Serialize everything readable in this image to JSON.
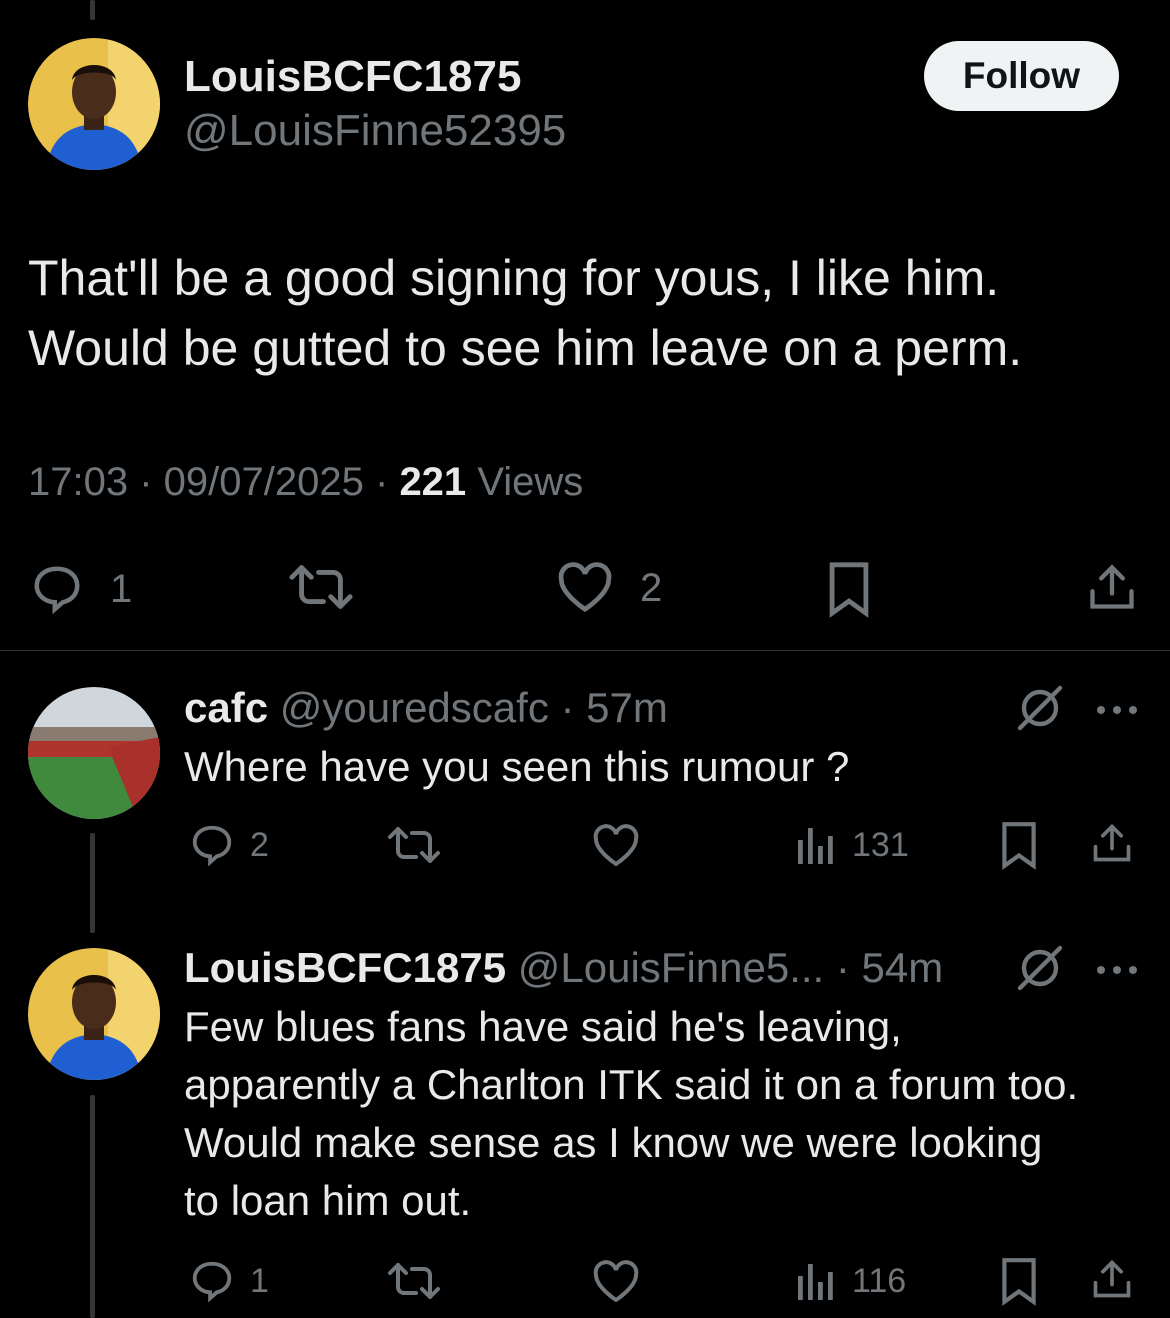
{
  "colors": {
    "background": "#000000",
    "text": "#e7e9ea",
    "muted": "#71767b",
    "divider": "#2f3336",
    "follow_bg": "#eff3f4"
  },
  "main_tweet": {
    "display_name": "LouisBCFC1875",
    "handle": "@LouisFinne52395",
    "follow_label": "Follow",
    "text": "That'll be a good signing for yous, I like him. Would be gutted to see him leave on a perm.",
    "time": "17:03",
    "date": "09/07/2025",
    "views_count": "221",
    "views_label": "Views",
    "replies": "1",
    "likes": "2"
  },
  "replies": [
    {
      "display_name": "cafc",
      "handle": "@youredscafc",
      "age": "57m",
      "text": "Where have you seen this rumour ?",
      "replies": "2",
      "views": "131"
    },
    {
      "display_name": "LouisBCFC1875",
      "handle": "@LouisFinne5...",
      "age": "54m",
      "text": "Few blues fans have said he's leaving, apparently a Charlton ITK said it on a forum too. Would make sense as I know we were looking to loan him out.",
      "replies": "1",
      "views": "116"
    }
  ],
  "icons": [
    "reply-icon",
    "retweet-icon",
    "like-icon",
    "bookmark-icon",
    "share-icon",
    "views-icon",
    "grok-icon",
    "more-icon"
  ]
}
